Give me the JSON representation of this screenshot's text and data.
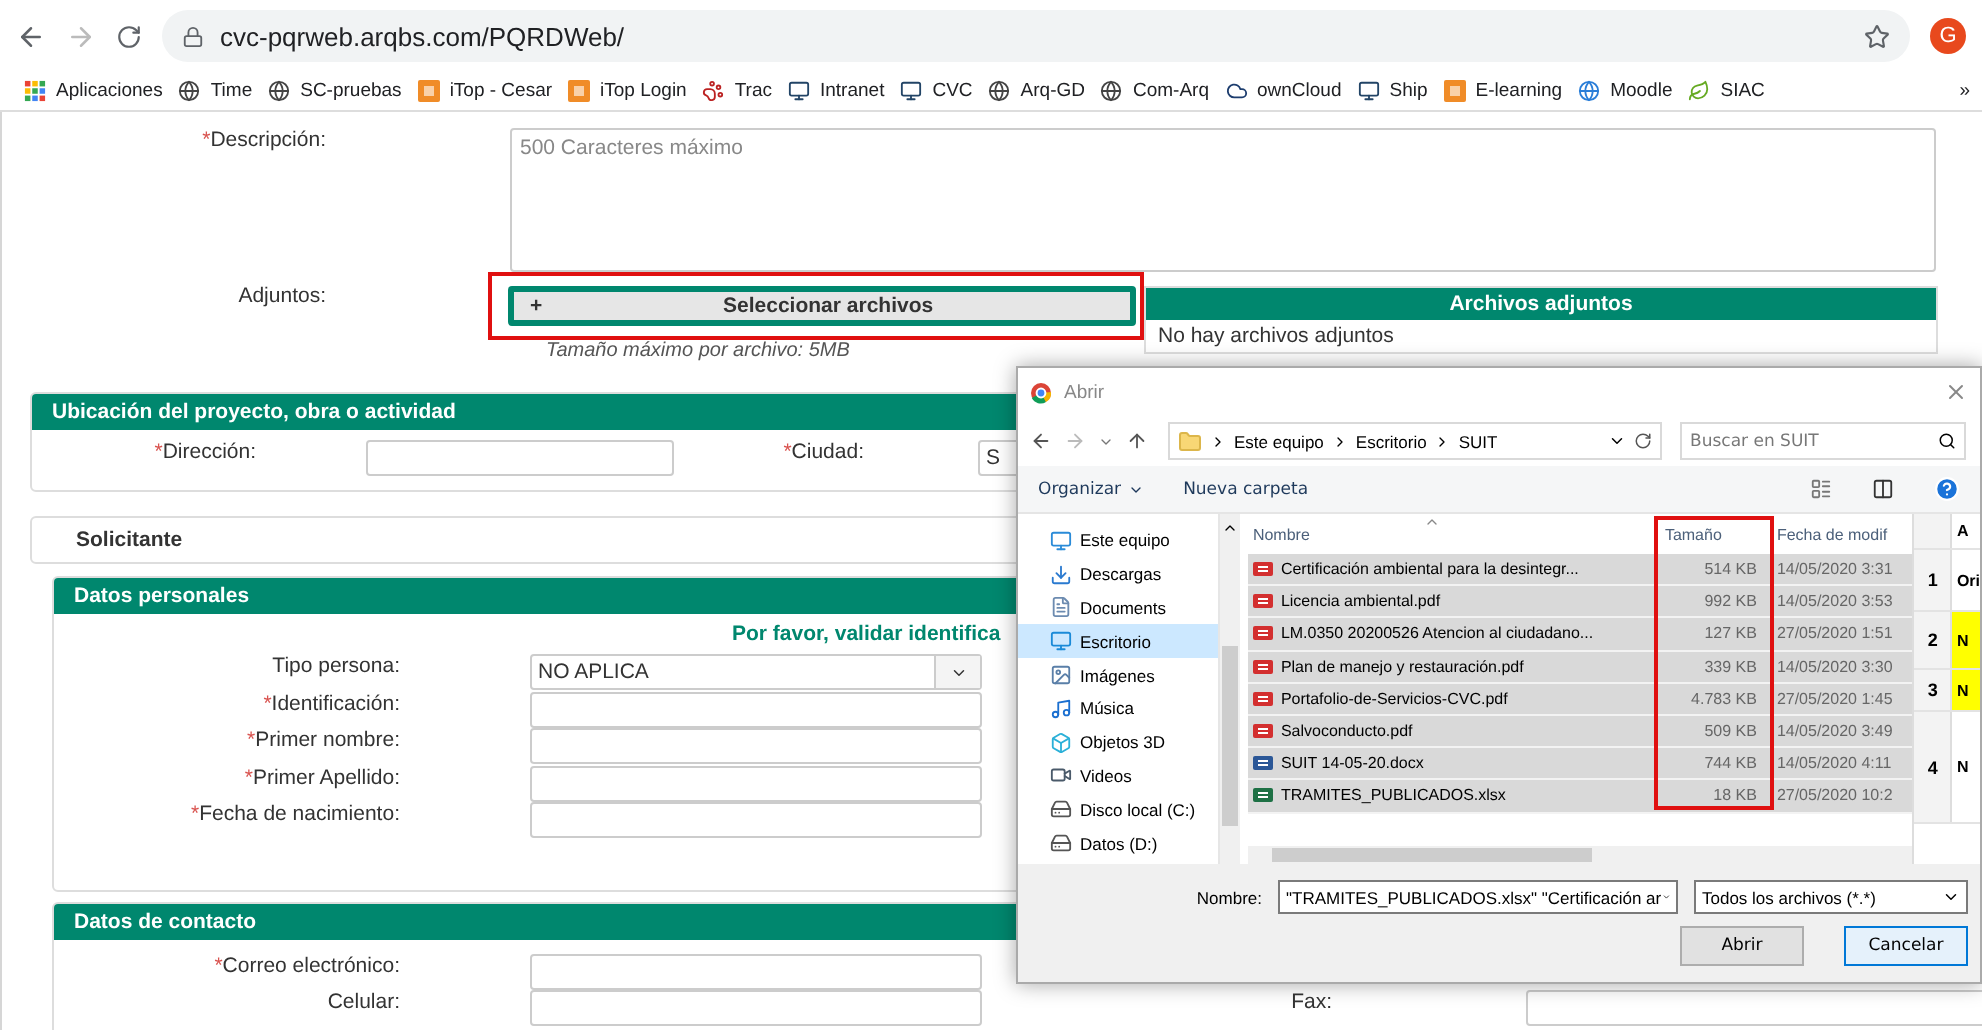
{
  "browser": {
    "url": "cvc-pqrweb.arqbs.com/PQRDWeb/",
    "profile_initial": "G",
    "bookmarks": [
      {
        "label": "Aplicaciones",
        "kind": "apps"
      },
      {
        "label": "Time",
        "kind": "globe"
      },
      {
        "label": "SC-pruebas",
        "kind": "globe"
      },
      {
        "label": "iTop - Cesar",
        "kind": "site"
      },
      {
        "label": "iTop Login",
        "kind": "site"
      },
      {
        "label": "Trac",
        "kind": "paw"
      },
      {
        "label": "Intranet",
        "kind": "monitor"
      },
      {
        "label": "CVC",
        "kind": "monitor"
      },
      {
        "label": "Arq-GD",
        "kind": "globe"
      },
      {
        "label": "Com-Arq",
        "kind": "globe"
      },
      {
        "label": "ownCloud",
        "kind": "cloud"
      },
      {
        "label": "Ship",
        "kind": "monitor"
      },
      {
        "label": "E-learning",
        "kind": "site"
      },
      {
        "label": "Moodle",
        "kind": "ball"
      },
      {
        "label": "SIAC",
        "kind": "leaf"
      }
    ],
    "more": "»"
  },
  "form": {
    "description": {
      "required_mark": "*",
      "label": "Descripción:",
      "placeholder": "500 Caracteres máximo"
    },
    "attachments": {
      "label": "Adjuntos:",
      "button_icon": "+",
      "button": "Seleccionar archivos",
      "caption": "Tamaño máximo por archivo: 5MB",
      "panel_title": "Archivos adjuntos",
      "panel_text": "No hay archivos adjuntos"
    },
    "location": {
      "title": "Ubicación del proyecto, obra o actividad",
      "fields": [
        {
          "required_mark": "*",
          "label": "Dirección:"
        },
        {
          "required_mark": "*",
          "label": "Ciudad:",
          "value": "S"
        }
      ]
    },
    "applicant": {
      "title": "Solicitante"
    },
    "personal": {
      "title": "Datos personales",
      "notice": "Por favor, validar identifica",
      "fields": [
        {
          "label": "Tipo persona:",
          "kind": "select",
          "value": "NO APLICA"
        },
        {
          "required_mark": "*",
          "label": "Identificación:",
          "kind": "input"
        },
        {
          "required_mark": "*",
          "label": "Primer nombre:",
          "kind": "input"
        },
        {
          "required_mark": "*",
          "label": "Primer Apellido:",
          "kind": "input"
        },
        {
          "required_mark": "*",
          "label": "Fecha de nacimiento:",
          "kind": "input"
        }
      ]
    },
    "contact": {
      "title": "Datos de contacto",
      "fields": [
        {
          "required_mark": "*",
          "label": "Correo electrónico:"
        },
        {
          "label": "Celular:"
        }
      ],
      "fax_label": "Fax:"
    }
  },
  "dialog": {
    "title": "Abrir",
    "path": [
      "Este equipo",
      "Escritorio",
      "SUIT"
    ],
    "search_placeholder": "Buscar en SUIT",
    "organize": "Organizar",
    "new_folder": "Nueva carpeta",
    "sidebar": [
      {
        "label": "Este equipo",
        "kind": "computer",
        "selected": false
      },
      {
        "label": "Descargas",
        "kind": "downloads",
        "selected": false
      },
      {
        "label": "Documents",
        "kind": "documents",
        "selected": false
      },
      {
        "label": "Escritorio",
        "kind": "desktop",
        "selected": true
      },
      {
        "label": "Imágenes",
        "kind": "pictures",
        "selected": false
      },
      {
        "label": "Música",
        "kind": "music",
        "selected": false
      },
      {
        "label": "Objetos 3D",
        "kind": "objects",
        "selected": false
      },
      {
        "label": "Videos",
        "kind": "videos",
        "selected": false
      },
      {
        "label": "Disco local (C:)",
        "kind": "drive",
        "selected": false
      },
      {
        "label": "Datos (D:)",
        "kind": "drive",
        "selected": false
      }
    ],
    "columns": [
      "Nombre",
      "Tamaño",
      "Fecha de modif"
    ],
    "files": [
      {
        "name": "Certificación ambiental para la desintegr...",
        "size": "514 KB",
        "date": "14/05/2020 3:31",
        "kind": "pdf",
        "selected": true
      },
      {
        "name": "Licencia ambiental.pdf",
        "size": "992 KB",
        "date": "14/05/2020 3:53",
        "kind": "pdf",
        "selected": true
      },
      {
        "name": "LM.0350 20200526 Atencion al ciudadano...",
        "size": "127 KB",
        "date": "27/05/2020 1:51",
        "kind": "pdf",
        "selected": true
      },
      {
        "name": "Plan de manejo y restauración.pdf",
        "size": "339 KB",
        "date": "14/05/2020 3:30",
        "kind": "pdf",
        "selected": true
      },
      {
        "name": "Portafolio-de-Servicios-CVC.pdf",
        "size": "4.783 KB",
        "date": "27/05/2020 1:45",
        "kind": "pdf",
        "selected": true
      },
      {
        "name": "Salvoconducto.pdf",
        "size": "509 KB",
        "date": "14/05/2020 3:49",
        "kind": "pdf",
        "selected": true
      },
      {
        "name": "SUIT 14-05-20.docx",
        "size": "744 KB",
        "date": "14/05/2020 4:11",
        "kind": "docx",
        "selected": true
      },
      {
        "name": "TRAMITES_PUBLICADOS.xlsx",
        "size": "18 KB",
        "date": "27/05/2020 10:2",
        "kind": "xlsx",
        "selected": true
      }
    ],
    "preview": {
      "header": "A",
      "rows": [
        {
          "number": "1",
          "cell": "Ori",
          "highlighted": false
        },
        {
          "number": "2",
          "cell": "N",
          "highlighted": true
        },
        {
          "number": "3",
          "cell": "N",
          "highlighted": true
        },
        {
          "number": "4",
          "cell": "N",
          "highlighted": false
        }
      ]
    },
    "name_label": "Nombre:",
    "name_value": "\"TRAMITES_PUBLICADOS.xlsx\" \"Certificación ar",
    "filter": "Todos los archivos (*.*)",
    "open": "Abrir",
    "cancel": "Cancelar"
  }
}
